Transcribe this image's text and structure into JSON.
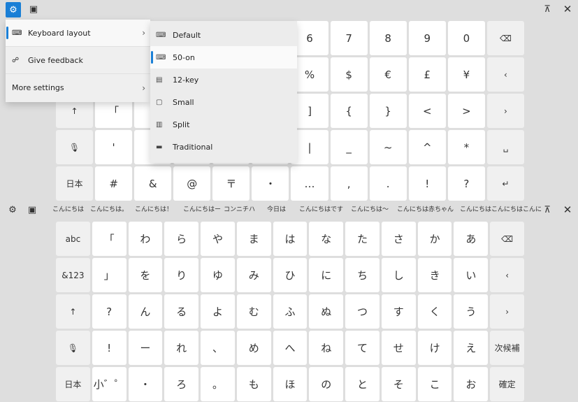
{
  "accent_color": "#1a7fd6",
  "top_toolbar": {
    "settings_icon": "gear-icon",
    "sticker_icon": "sticker-icon",
    "dock_icon": "dock-icon",
    "close_icon": "close-icon"
  },
  "top_keyboard": {
    "rows": [
      [
        "",
        "",
        "",
        "",
        "",
        "",
        "6",
        "7",
        "8",
        "9",
        "0",
        "⌫"
      ],
      [
        "",
        "",
        "",
        "",
        "",
        "",
        "%",
        "$",
        "€",
        "£",
        "¥",
        "‹"
      ],
      [
        "↑",
        "「",
        "",
        "",
        "",
        "",
        "]",
        "{",
        "}",
        "<",
        ">",
        "›"
      ],
      [
        "🎙",
        "'",
        "",
        "",
        "",
        "",
        "|",
        "_",
        "~",
        "^",
        "*",
        "␣"
      ],
      [
        "日本",
        "#",
        "&",
        "@",
        "〒",
        "・",
        "…",
        ",",
        ".",
        "!",
        "?",
        "↵"
      ]
    ]
  },
  "menu": {
    "items": [
      {
        "label": "Keyboard layout",
        "icon": "keyboard-icon",
        "has_submenu": true,
        "active": true
      },
      {
        "label": "Give feedback",
        "icon": "feedback-icon",
        "has_submenu": false
      },
      {
        "label": "More settings",
        "icon": "",
        "has_submenu": true
      }
    ],
    "submenu": [
      {
        "label": "Default",
        "icon": "keyboard-icon"
      },
      {
        "label": "50-on",
        "icon": "keyboard-icon",
        "selected": true
      },
      {
        "label": "12-key",
        "icon": "keypad-icon"
      },
      {
        "label": "Small",
        "icon": "small-keyboard-icon"
      },
      {
        "label": "Split",
        "icon": "split-keyboard-icon"
      },
      {
        "label": "Traditional",
        "icon": "traditional-keyboard-icon"
      }
    ]
  },
  "suggestions": [
    "こんにちは",
    "こんにちは。",
    "こんにちは！",
    "こんにちはー",
    "コンニチハ",
    "今日は",
    "こんにちはです",
    "こんにちは〜",
    "こんにちは赤ちゃん",
    "こんにちはこんにちは",
    "こんに"
  ],
  "bottom_keyboard": {
    "rows": [
      [
        "abc",
        "「",
        "わ",
        "ら",
        "や",
        "ま",
        "は",
        "な",
        "た",
        "さ",
        "か",
        "あ",
        "⌫"
      ],
      [
        "&123",
        "」",
        "を",
        "り",
        "ゆ",
        "み",
        "ひ",
        "に",
        "ち",
        "し",
        "き",
        "い",
        "‹"
      ],
      [
        "↑",
        "?",
        "ん",
        "る",
        "よ",
        "む",
        "ふ",
        "ぬ",
        "つ",
        "す",
        "く",
        "う",
        "›"
      ],
      [
        "🎙",
        "!",
        "ー",
        "れ",
        "、",
        "め",
        "へ",
        "ね",
        "て",
        "せ",
        "け",
        "え",
        "次候補"
      ],
      [
        "日本",
        "小゛゜",
        "・",
        "ろ",
        "。",
        "も",
        "ほ",
        "の",
        "と",
        "そ",
        "こ",
        "お",
        "確定"
      ]
    ]
  }
}
